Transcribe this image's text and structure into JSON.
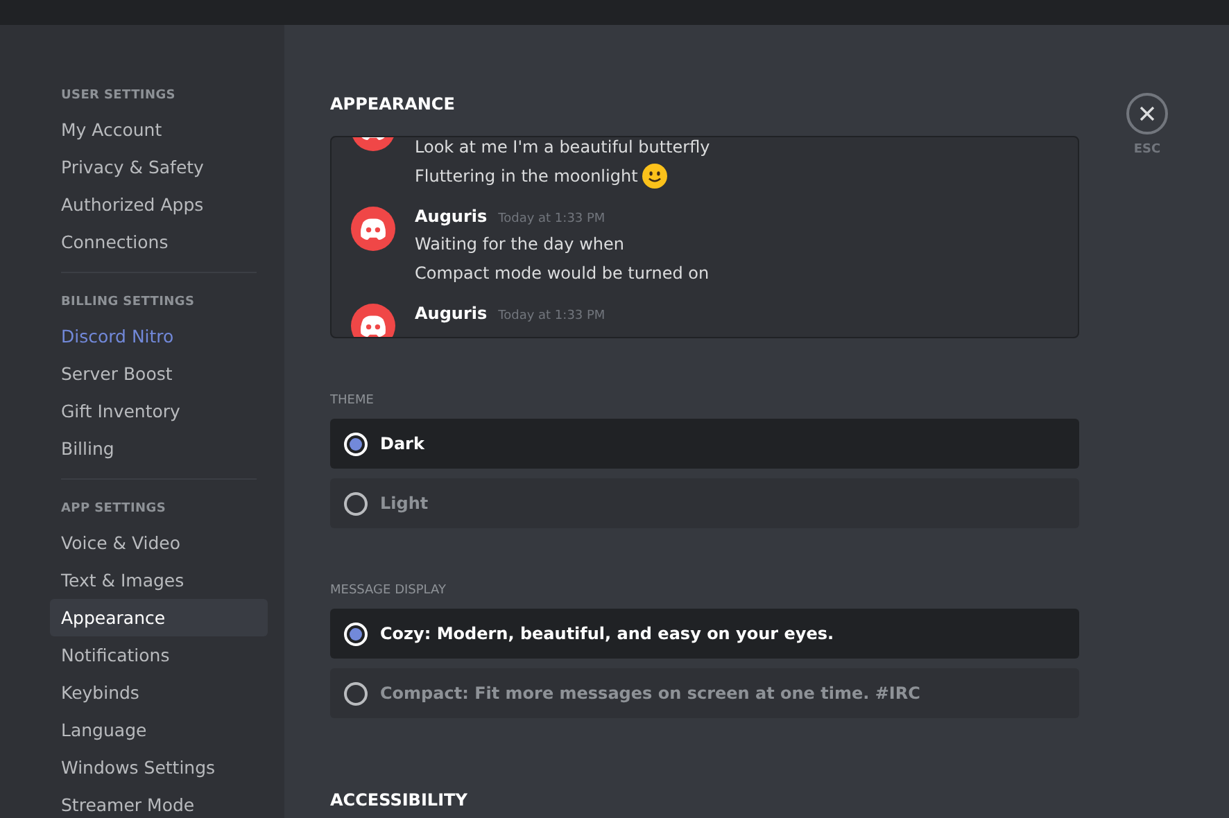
{
  "sidebar": {
    "groups": [
      {
        "heading": "USER SETTINGS",
        "items": [
          {
            "label": "My Account",
            "selected": false
          },
          {
            "label": "Privacy & Safety",
            "selected": false
          },
          {
            "label": "Authorized Apps",
            "selected": false
          },
          {
            "label": "Connections",
            "selected": false
          }
        ]
      },
      {
        "heading": "BILLING SETTINGS",
        "items": [
          {
            "label": "Discord Nitro",
            "selected": false,
            "kind": "accent"
          },
          {
            "label": "Server Boost",
            "selected": false
          },
          {
            "label": "Gift Inventory",
            "selected": false
          },
          {
            "label": "Billing",
            "selected": false
          }
        ]
      },
      {
        "heading": "APP SETTINGS",
        "items": [
          {
            "label": "Voice & Video",
            "selected": false
          },
          {
            "label": "Text & Images",
            "selected": false
          },
          {
            "label": "Appearance",
            "selected": true
          },
          {
            "label": "Notifications",
            "selected": false
          },
          {
            "label": "Keybinds",
            "selected": false
          },
          {
            "label": "Language",
            "selected": false
          },
          {
            "label": "Windows Settings",
            "selected": false
          },
          {
            "label": "Streamer Mode",
            "selected": false
          }
        ]
      }
    ]
  },
  "title": "APPEARANCE",
  "preview": {
    "messages": [
      {
        "lines": [
          {
            "text": "Look at me I'm a beautiful butterfly",
            "emoji": false
          },
          {
            "text": "Fluttering in the moonlight",
            "emoji": true
          }
        ]
      },
      {
        "author": "Auguris",
        "timestamp": "Today at 1:33 PM",
        "lines": [
          {
            "text": "Waiting for the day when",
            "emoji": false
          },
          {
            "text": "Compact mode would be turned on",
            "emoji": false
          }
        ]
      },
      {
        "author": "Auguris",
        "timestamp": "Today at 1:33 PM"
      }
    ]
  },
  "sections": [
    {
      "heading": "THEME",
      "options": [
        {
          "label": "Dark",
          "selected": true
        },
        {
          "label": "Light",
          "selected": false
        }
      ]
    },
    {
      "heading": "MESSAGE DISPLAY",
      "options": [
        {
          "label": "Cozy: Modern, beautiful, and easy on your eyes.",
          "selected": true
        },
        {
          "label": "Compact: Fit more messages on screen at one time. #IRC",
          "selected": false
        }
      ]
    }
  ],
  "next_heading": "ACCESSIBILITY",
  "close": {
    "label": "ESC"
  }
}
